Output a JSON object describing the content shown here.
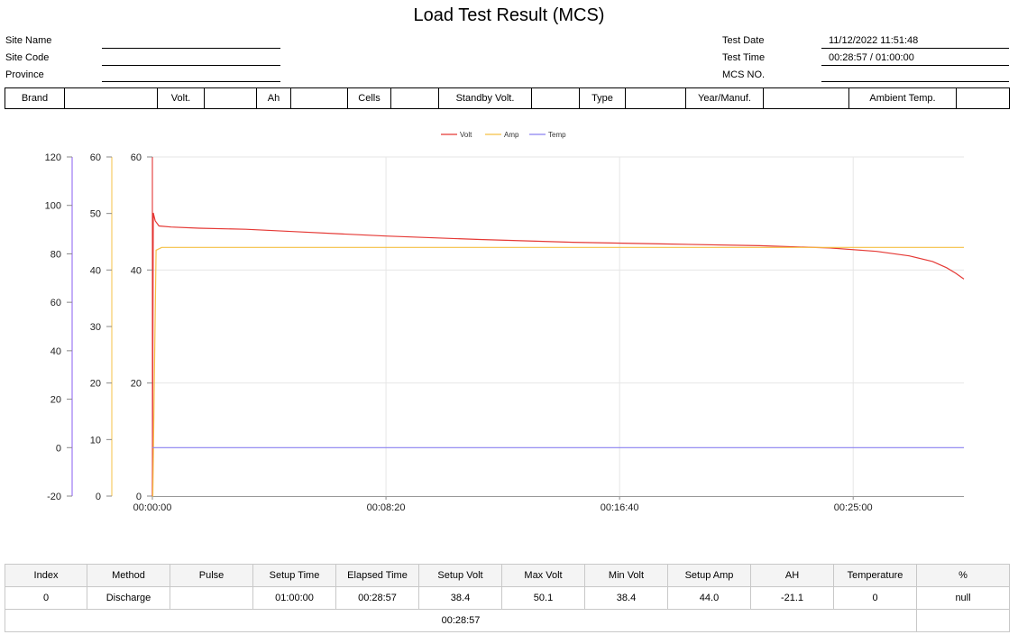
{
  "report": {
    "title": "Load Test Result (MCS)",
    "site_name_label": "Site Name",
    "site_code_label": "Site Code",
    "province_label": "Province",
    "test_date_label": "Test Date",
    "test_date_value": "11/12/2022 11:51:48",
    "test_time_label": "Test Time",
    "test_time_value": "00:28:57 / 01:00:00",
    "mcs_no_label": "MCS NO."
  },
  "spec_row": [
    "Brand",
    "",
    "Volt.",
    "",
    "Ah",
    "",
    "Cells",
    "",
    "Standby Volt.",
    "",
    "Type",
    "",
    "Year/Manuf.",
    "",
    "Ambient Temp.",
    ""
  ],
  "chart_data": {
    "type": "line",
    "legend_position": "top-center",
    "x_ticks": [
      "00:00:00",
      "00:08:20",
      "00:16:40",
      "00:25:00"
    ],
    "xlim_seconds": [
      0,
      1737
    ],
    "axes": [
      {
        "name": "temp",
        "color": "#8a5cf0",
        "ylim": [
          -20,
          120
        ],
        "ticks": [
          -20,
          0,
          20,
          40,
          60,
          80,
          100,
          120
        ]
      },
      {
        "name": "amp",
        "color": "#f5c044",
        "ylim": [
          0,
          60
        ],
        "ticks": [
          0,
          10,
          20,
          30,
          40,
          50,
          60
        ]
      },
      {
        "name": "volt",
        "color": "#e02020",
        "ylim": [
          0,
          60
        ],
        "ticks": [
          0,
          20,
          40,
          60
        ]
      }
    ],
    "grid": true,
    "series": [
      {
        "name": "Volt",
        "color": "#e53935",
        "axis": "volt",
        "t": [
          0,
          2,
          6,
          14,
          40,
          100,
          200,
          300,
          500,
          700,
          900,
          1100,
          1300,
          1450,
          1550,
          1620,
          1670,
          1700,
          1720,
          1737
        ],
        "values": [
          0,
          50.1,
          48.7,
          47.8,
          47.6,
          47.4,
          47.2,
          46.8,
          46.0,
          45.4,
          44.9,
          44.6,
          44.3,
          43.9,
          43.3,
          42.5,
          41.5,
          40.4,
          39.4,
          38.4
        ]
      },
      {
        "name": "Amp",
        "color": "#f5c044",
        "axis": "amp",
        "t": [
          0,
          1,
          4,
          8,
          20,
          1737
        ],
        "values": [
          0,
          0,
          20,
          43.5,
          44.0,
          44.0
        ]
      },
      {
        "name": "Temp",
        "color": "#8a80f0",
        "axis": "temp",
        "t": [
          0,
          1737
        ],
        "values": [
          0,
          0
        ]
      }
    ]
  },
  "results": {
    "headers": [
      "Index",
      "Method",
      "Pulse",
      "Setup Time",
      "Elapsed Time",
      "Setup Volt",
      "Max Volt",
      "Min Volt",
      "Setup Amp",
      "AH",
      "Temperature",
      "%"
    ],
    "row": [
      "0",
      "Discharge",
      "",
      "01:00:00",
      "00:28:57",
      "38.4",
      "50.1",
      "38.4",
      "44.0",
      "-21.1",
      "0",
      "null"
    ],
    "footer": "00:28:57"
  }
}
